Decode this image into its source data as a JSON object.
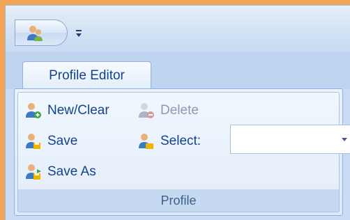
{
  "tabs": [
    {
      "label": "Profile Editor",
      "selected": true
    }
  ],
  "ribbon": {
    "group_label": "Profile",
    "buttons": {
      "new_clear": {
        "label": "New/Clear",
        "icon": "user-add-icon",
        "enabled": true
      },
      "delete": {
        "label": "Delete",
        "icon": "user-delete-icon",
        "enabled": false
      },
      "save": {
        "label": "Save",
        "icon": "user-save-icon",
        "enabled": true
      },
      "select": {
        "label": "Select:",
        "icon": "user-select-icon",
        "enabled": true
      },
      "save_as": {
        "label": "Save As",
        "icon": "user-save-as-icon",
        "enabled": true
      }
    },
    "select_value": ""
  },
  "app_button": {
    "icon": "users-icon"
  },
  "qat": {
    "customize_icon": "qat-customize-dropdown-icon"
  },
  "colors": {
    "accent_text": "#15428b",
    "frame": "#f4a455",
    "ribbon_bg": "#c9dcf3"
  }
}
